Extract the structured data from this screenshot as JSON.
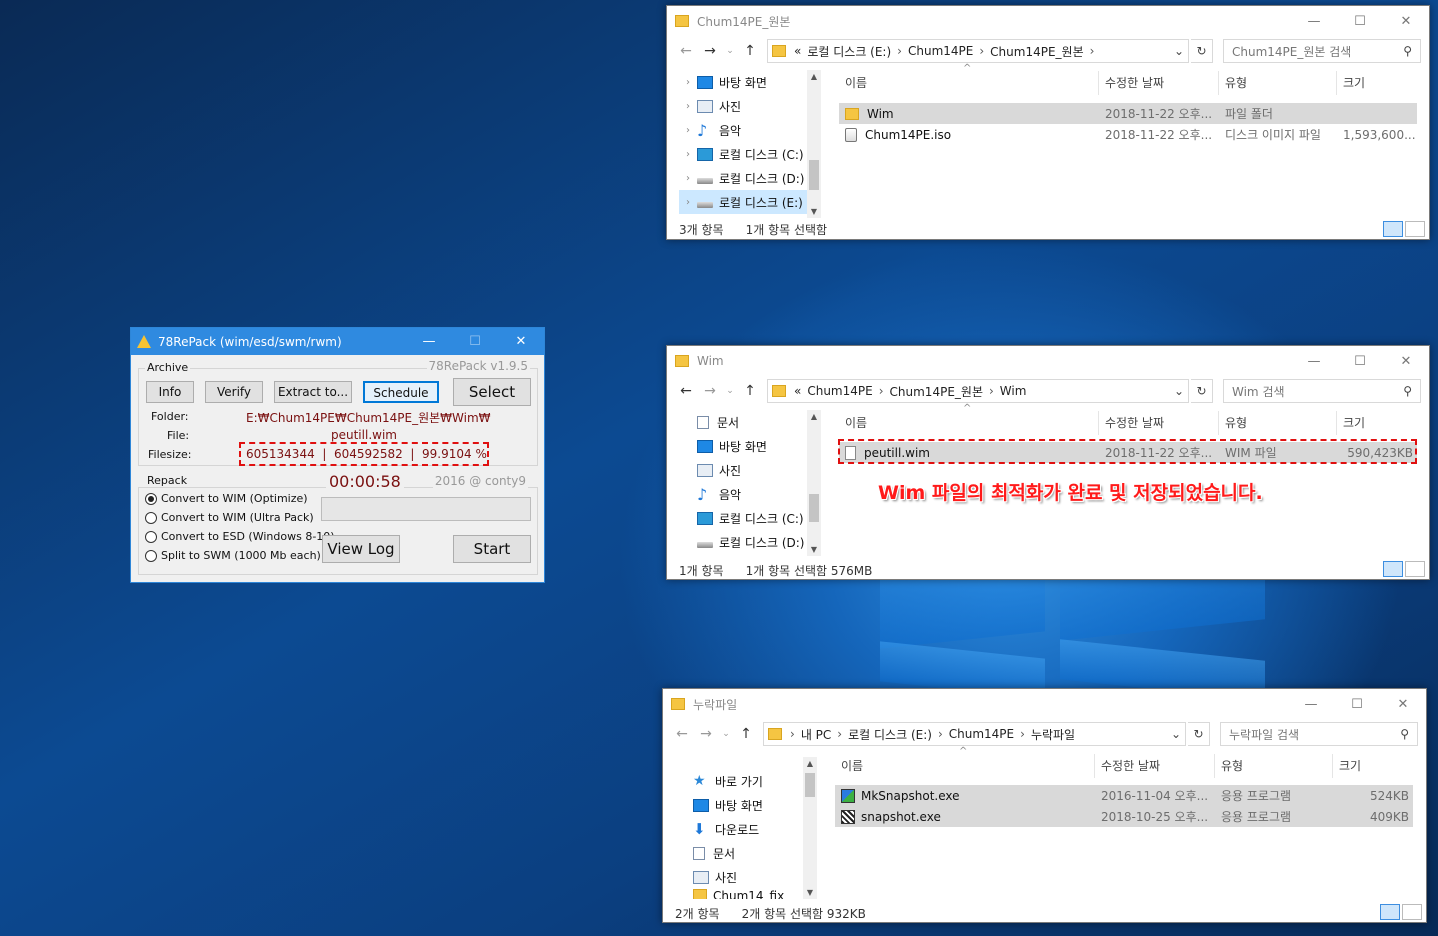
{
  "win1": {
    "title": "Chum14PE_원본",
    "address": {
      "prefix": "«",
      "crumbs": [
        "로컬 디스크 (E:)",
        "Chum14PE",
        "Chum14PE_원본"
      ]
    },
    "search_placeholder": "Chum14PE_원본 검색",
    "tree": [
      "바탕 화면",
      "사진",
      "음악",
      "로컬 디스크 (C:)",
      "로컬 디스크 (D:)",
      "로컬 디스크 (E:)"
    ],
    "columns": [
      "이름",
      "수정한 날짜",
      "유형",
      "크기"
    ],
    "rows": [
      {
        "name": "Wim",
        "date": "2018-11-22 오후...",
        "type": "파일 폴더",
        "size": ""
      },
      {
        "name": "Chum14PE.iso",
        "date": "2018-11-22 오후...",
        "type": "디스크 이미지 파일",
        "size": "1,593,600..."
      }
    ],
    "status": [
      "3개 항목",
      "1개 항목 선택함"
    ]
  },
  "win2": {
    "title": "Wim",
    "address": {
      "prefix": "«",
      "crumbs": [
        "Chum14PE",
        "Chum14PE_원본",
        "Wim"
      ]
    },
    "search_placeholder": "Wim 검색",
    "tree": [
      "문서",
      "바탕 화면",
      "사진",
      "음악",
      "로컬 디스크 (C:)",
      "로컬 디스크 (D:)"
    ],
    "columns": [
      "이름",
      "수정한 날짜",
      "유형",
      "크기"
    ],
    "rows": [
      {
        "name": "peutill.wim",
        "date": "2018-11-22 오후...",
        "type": "WIM 파일",
        "size": "590,423KB"
      }
    ],
    "status": [
      "1개 항목",
      "1개 항목 선택함 576MB"
    ],
    "callout": "Wim 파일의 최적화가 완료 및 저장되었습니다."
  },
  "win3": {
    "title": "누락파일",
    "address": {
      "prefix": "",
      "crumbs": [
        "내 PC",
        "로컬 디스크 (E:)",
        "Chum14PE",
        "누락파일"
      ]
    },
    "search_placeholder": "누락파일 검색",
    "tree": [
      "바로 가기",
      "바탕 화면",
      "다운로드",
      "문서",
      "사진",
      "Chum14_fix"
    ],
    "columns": [
      "이름",
      "수정한 날짜",
      "유형",
      "크기"
    ],
    "rows": [
      {
        "name": "MkSnapshot.exe",
        "date": "2016-11-04 오후...",
        "type": "응용 프로그램",
        "size": "524KB"
      },
      {
        "name": "snapshot.exe",
        "date": "2018-10-25 오후...",
        "type": "응용 프로그램",
        "size": "409KB"
      }
    ],
    "status": [
      "2개 항목",
      "2개 항목 선택함 932KB"
    ]
  },
  "repack": {
    "title": "78RePack (wim/esd/swm/rwm)",
    "archive_label": "Archive",
    "version": "78RePack v1.9.5",
    "buttons": {
      "info": "Info",
      "verify": "Verify",
      "extract": "Extract to...",
      "schedule": "Schedule",
      "select": "Select",
      "viewlog": "View Log",
      "start": "Start"
    },
    "folder_label": "Folder:",
    "folder_value": "E:₩Chum14PE₩Chum14PE_원본₩Wim₩",
    "file_label": "File:",
    "file_value": "peutill.wim",
    "filesize_label": "Filesize:",
    "filesize_value": "605134344  |  604592582  |  99.9104 %",
    "repack_label": "Repack",
    "timer": "00:00:58",
    "credit": "2016 @ conty9",
    "options": [
      "Convert to WIM (Optimize)",
      "Convert to WIM (Ultra Pack)",
      "Convert to ESD (Windows 8-10)",
      "Split to SWM (1000 Mb each)"
    ],
    "selected_option": 0,
    "progress": 0
  },
  "titlebar_buttons": {
    "min": "—",
    "max": "☐",
    "close": "✕"
  },
  "colors": {
    "titlebar_active": "#2f8ae0",
    "callout": "#ff1a1a",
    "dashed_box": "#e01010",
    "selection": "#d9d9d9"
  }
}
